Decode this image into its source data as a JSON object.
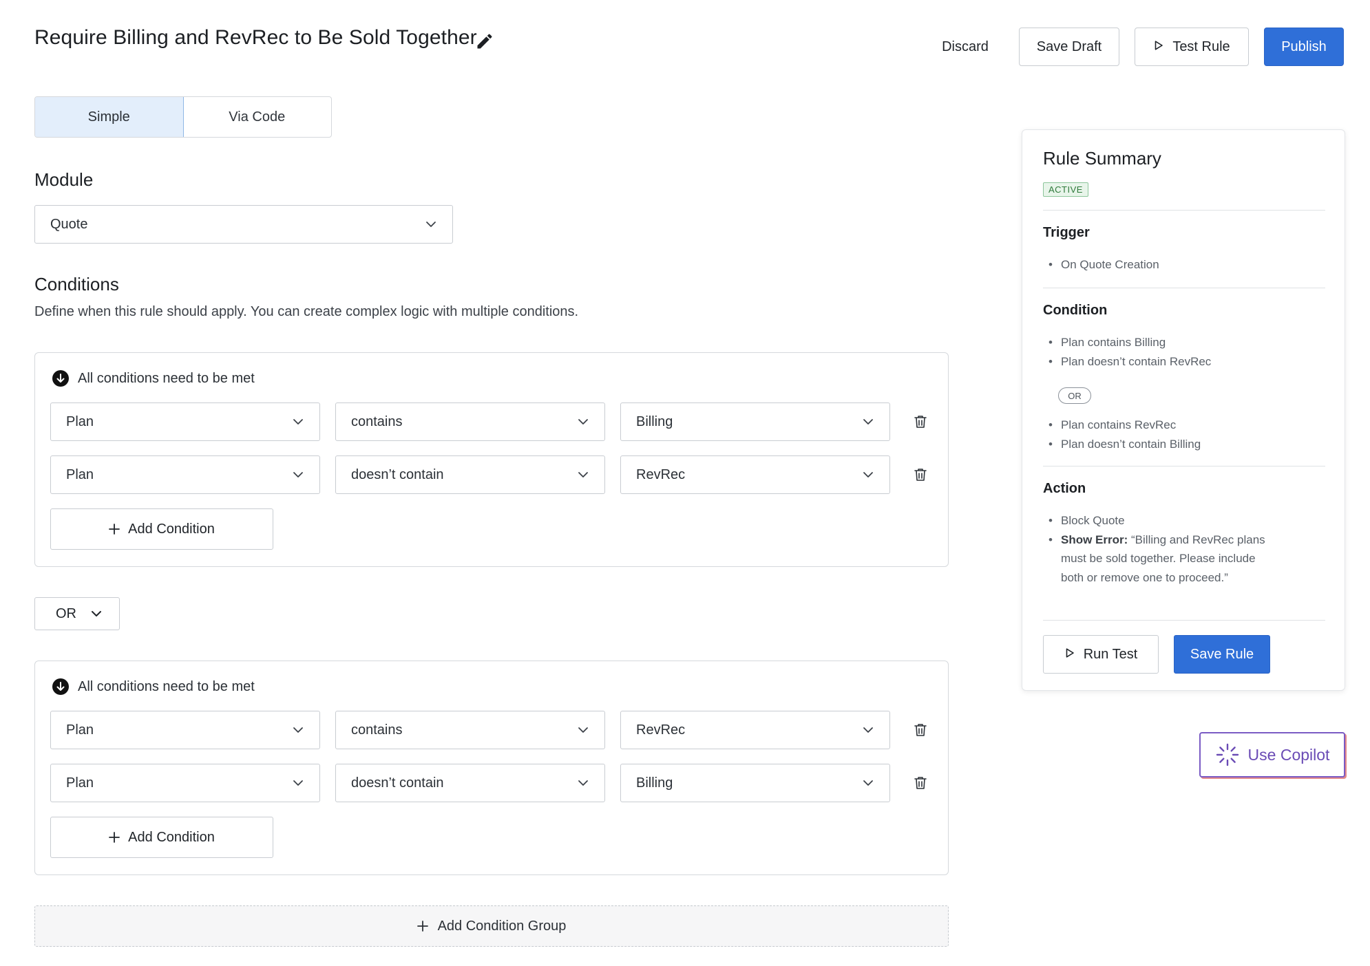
{
  "header": {
    "title": "Require Billing and RevRec to Be Sold Together",
    "discard_label": "Discard",
    "save_draft_label": "Save Draft",
    "test_rule_label": "Test Rule",
    "publish_label": "Publish"
  },
  "mode_tabs": [
    {
      "label": "Simple",
      "active": true
    },
    {
      "label": "Via Code",
      "active": false
    }
  ],
  "module": {
    "title": "Module",
    "selected": "Quote"
  },
  "conditions": {
    "title": "Conditions",
    "description": "Define when this rule should apply. You can create complex logic with multiple conditions.",
    "groups": [
      {
        "header": "All conditions need to be met",
        "rows": [
          {
            "field": "Plan",
            "operator": "contains",
            "value": "Billing"
          },
          {
            "field": "Plan",
            "operator": "doesn’t contain",
            "value": "RevRec"
          }
        ],
        "add_label": "Add Condition"
      },
      {
        "header": "All conditions need to be met",
        "rows": [
          {
            "field": "Plan",
            "operator": "contains",
            "value": "RevRec"
          },
          {
            "field": "Plan",
            "operator": "doesn’t contain",
            "value": "Billing"
          }
        ],
        "add_label": "Add Condition"
      }
    ],
    "group_join": "OR",
    "add_group_label": "Add Condition Group"
  },
  "summary": {
    "title": "Rule Summary",
    "status": "ACTIVE",
    "trigger_title": "Trigger",
    "trigger_items": [
      "On Quote Creation"
    ],
    "condition_title": "Condition",
    "condition_group_1": [
      "Plan contains Billing",
      "Plan doesn’t contain RevRec"
    ],
    "condition_join": "OR",
    "condition_group_2": [
      "Plan contains RevRec",
      "Plan doesn’t contain Billing"
    ],
    "action_title": "Action",
    "action_item_1": "Block Quote",
    "action_error_label": "Show Error:",
    "action_error_text": " “Billing and RevRec plans must be sold together. Please include both or remove one to proceed.”",
    "run_test_label": "Run Test",
    "save_rule_label": "Save Rule"
  },
  "copilot_label": "Use Copilot",
  "colors": {
    "primary": "#2f6fd8",
    "active_tab_bg": "#e3eefb",
    "badge_green": "#2f7a3b",
    "copilot_purple": "#6a4bb5"
  },
  "icons": {
    "edit": "pencil-icon",
    "play": "play-icon",
    "chevron": "chevron-down-icon",
    "group": "arrow-down-circle-icon",
    "delete": "trash-icon",
    "add": "plus-icon",
    "copilot": "sparkle-loader-icon"
  }
}
